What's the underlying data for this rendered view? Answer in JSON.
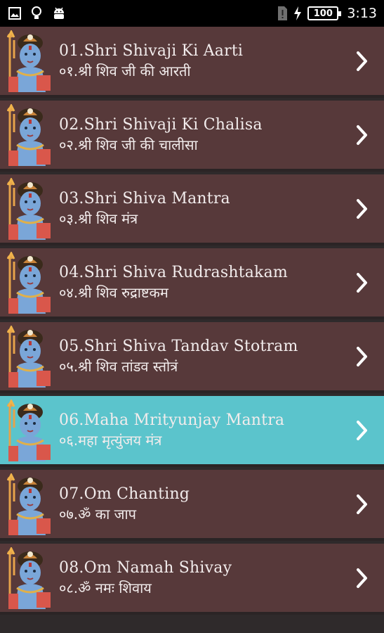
{
  "status_bar": {
    "battery": "100",
    "time": "3:13",
    "left_icons": [
      "image-icon",
      "lightbulb-icon",
      "android-icon"
    ],
    "right_icons": [
      "sim-alert-icon",
      "charging-icon",
      "battery-icon"
    ]
  },
  "colors": {
    "row_bg": "#57393a",
    "row_active_bg": "#5bc4cc",
    "separator": "#2b2425",
    "text": "#f2ecec"
  },
  "items": [
    {
      "title": "01.Shri Shivaji Ki Aarti",
      "subtitle": "०१.श्री शिव जी की आरती",
      "icon": "shiva-icon",
      "active": false
    },
    {
      "title": "02.Shri Shivaji Ki Chalisa",
      "subtitle": "०२.श्री शिव जी की चालीसा",
      "icon": "shiva-icon",
      "active": false
    },
    {
      "title": "03.Shri Shiva Mantra",
      "subtitle": "०३.श्री शिव मंत्र",
      "icon": "shiva-icon",
      "active": false
    },
    {
      "title": "04.Shri Shiva Rudrashtakam",
      "subtitle": "०४.श्री शिव रुद्राष्टकम",
      "icon": "shiva-icon",
      "active": false
    },
    {
      "title": "05.Shri Shiva Tandav Stotram",
      "subtitle": "०५.श्री शिव तांडव स्तोत्रं",
      "icon": "shiva-icon",
      "active": false
    },
    {
      "title": "06.Maha Mrityunjay Mantra",
      "subtitle": "०६.महा मृत्युंजय मंत्र",
      "icon": "shiva-icon",
      "active": true
    },
    {
      "title": "07.Om Chanting",
      "subtitle": "०७.ॐ का जाप",
      "icon": "shiva-icon",
      "active": false
    },
    {
      "title": "08.Om Namah Shivay",
      "subtitle": "०८.ॐ नमः शिवाय",
      "icon": "shiva-icon",
      "active": false
    }
  ]
}
